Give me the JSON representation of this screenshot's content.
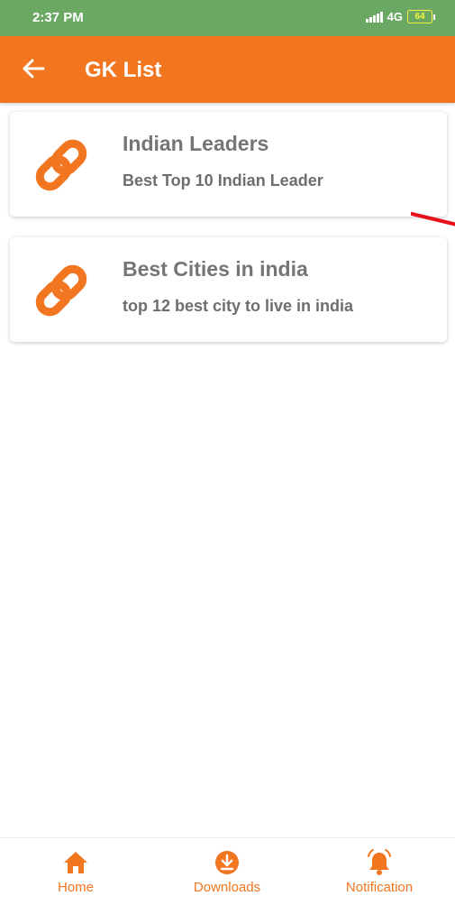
{
  "status_bar": {
    "time": "2:37 PM",
    "network": "4G",
    "battery": "64"
  },
  "app_bar": {
    "title": "GK List",
    "back_icon": "arrow-left-icon"
  },
  "list": [
    {
      "title": "Indian Leaders",
      "subtitle": "Best Top 10 Indian Leader",
      "icon": "link-icon"
    },
    {
      "title": "Best Cities in india",
      "subtitle": "top 12 best city to live in india",
      "icon": "link-icon"
    }
  ],
  "bottom_nav": {
    "items": [
      {
        "label": "Home",
        "icon": "home-icon"
      },
      {
        "label": "Downloads",
        "icon": "download-icon"
      },
      {
        "label": "Notification",
        "icon": "bell-icon"
      }
    ]
  },
  "colors": {
    "status_bar": "#6aa864",
    "primary": "#f27520",
    "title_text": "#757575",
    "annotation": "#e8101a"
  }
}
